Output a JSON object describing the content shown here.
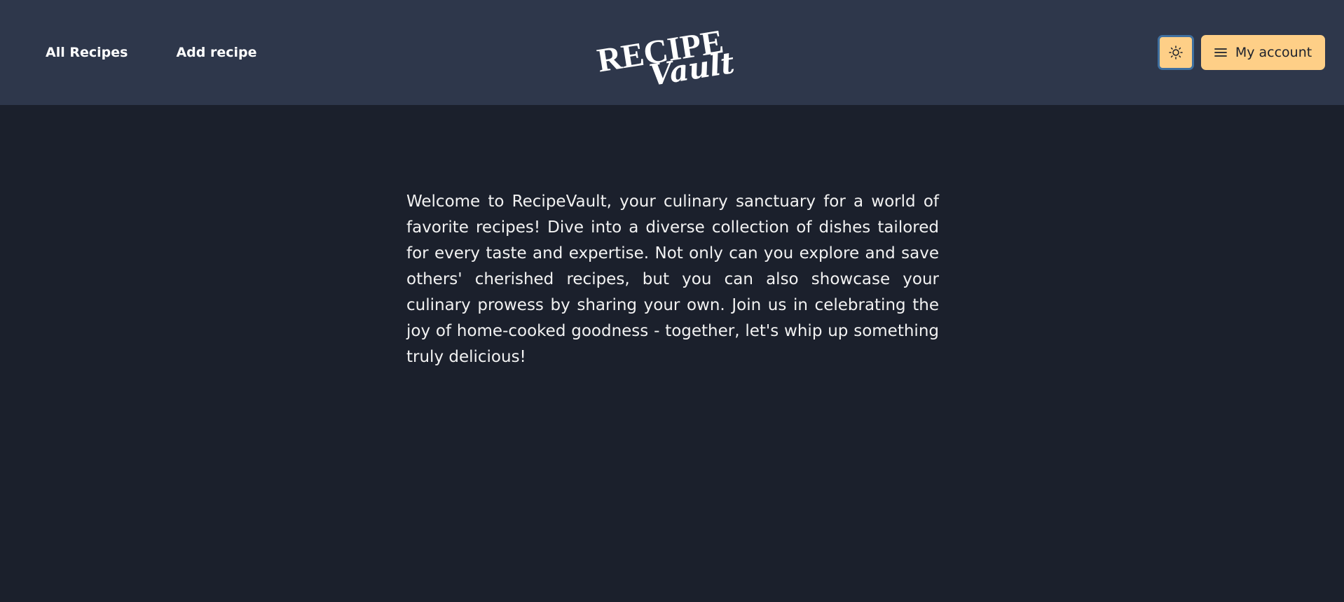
{
  "nav": {
    "all_recipes": "All Recipes",
    "add_recipe": "Add recipe"
  },
  "logo": {
    "line1": "RECIPE",
    "line2": "Vault"
  },
  "header": {
    "theme_toggle_icon": "sun-icon",
    "menu_icon": "hamburger-menu-icon",
    "account_label": "My account"
  },
  "main": {
    "welcome_text": "Welcome to RecipeVault, your culinary sanctuary for a world of favorite recipes! Dive into a diverse collection of dishes tailored for every taste and expertise. Not only can you explore and save others' cherished recipes, but you can also showcase your culinary prowess by sharing your own. Join us in celebrating the joy of home-cooked goodness - together, let's whip up something truly delicious!"
  },
  "colors": {
    "header_bg": "#2e374b",
    "page_bg": "#1b202c",
    "accent": "#fecf87",
    "focus_ring": "#3f6f9f",
    "text": "#ffffff"
  }
}
